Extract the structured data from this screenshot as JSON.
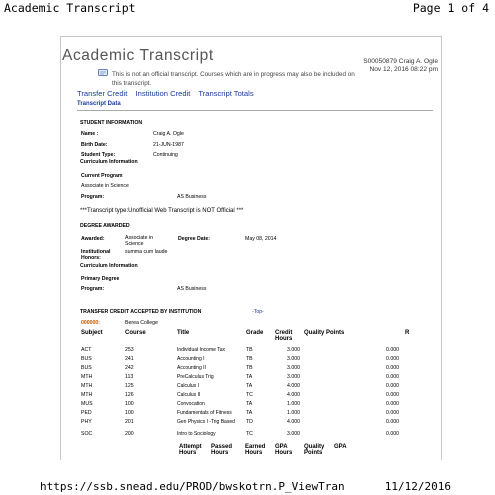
{
  "browser": {
    "page_title": "Academic Transcript",
    "page_count": "Page 1 of 4",
    "url": "https://ssb.snead.edu/PROD/bwskotrn.P_ViewTran",
    "print_date": "11/12/2016"
  },
  "header": {
    "title": "Academic Transcript",
    "student_id_name": "S00050879 Craig A. Ogle",
    "timestamp": "Nov 12, 2016 08:22 pm",
    "notice": "This is not an official transcript. Courses which are in progress may also be included on this transcript."
  },
  "nav": {
    "links": [
      "Transfer Credit",
      "Institution Credit",
      "Transcript Totals"
    ],
    "section": "Transcript Data"
  },
  "student_info": {
    "heading": "STUDENT INFORMATION",
    "name_label": "Name :",
    "name": "Craig A. Ogle",
    "birth_label": "Birth Date:",
    "birth": "21-JUN-1987",
    "type_label": "Student Type:",
    "type": "Continuing",
    "curriculum_heading": "Curriculum Information",
    "current_program_label": "Current Program",
    "current_program": "Associate in Science",
    "program_label": "Program:",
    "program": "AS Business",
    "transcript_type": "***Transcript type:Unofficial Web Transcript is NOT Official ***"
  },
  "degree": {
    "heading": "DEGREE AWARDED",
    "awarded_label": "Awarded:",
    "awarded": "Associate in Science",
    "degree_date_label": "Degree Date:",
    "degree_date": "May 08, 2014",
    "honors_label": "Institutional Honors:",
    "honors": "summa cum laude",
    "curriculum_heading": "Curriculum Information",
    "primary_label": "Primary Degree",
    "program_label": "Program:",
    "program": "AS Business"
  },
  "transfer": {
    "heading": "TRANSFER CREDIT ACCEPTED BY INSTITUTION",
    "top_link": "-Top-",
    "inst_code": "000000:",
    "inst_name": "Berea College",
    "columns": [
      "Subject",
      "Course",
      "Title",
      "Grade",
      "Credit Hours",
      "Quality Points",
      "R"
    ],
    "rows": [
      {
        "subject": "ACT",
        "course": "253",
        "title": "Individual Income Tax",
        "grade": "TB",
        "credit": "3.000",
        "qp": "0.000"
      },
      {
        "subject": "BUS",
        "course": "241",
        "title": "Accounting I",
        "grade": "TB",
        "credit": "3.000",
        "qp": "0.000"
      },
      {
        "subject": "BUS",
        "course": "242",
        "title": "Accounting II",
        "grade": "TB",
        "credit": "3.000",
        "qp": "0.000"
      },
      {
        "subject": "MTH",
        "course": "113",
        "title": "PreCalculus Trig",
        "grade": "TA",
        "credit": "3.000",
        "qp": "0.000"
      },
      {
        "subject": "MTH",
        "course": "125",
        "title": "Calculus I",
        "grade": "TA",
        "credit": "4.000",
        "qp": "0.000"
      },
      {
        "subject": "MTH",
        "course": "126",
        "title": "Calculus II",
        "grade": "TC",
        "credit": "4.000",
        "qp": "0.000"
      },
      {
        "subject": "MUS",
        "course": "100",
        "title": "Convocation",
        "grade": "TA",
        "credit": "1.000",
        "qp": "0.000"
      },
      {
        "subject": "PED",
        "course": "100",
        "title": "Fundamentals of Fitness",
        "grade": "TA",
        "credit": "1.000",
        "qp": "0.000"
      },
      {
        "subject": "PHY",
        "course": "201",
        "title": "Gen Physics I -Trig Based",
        "grade": "TD",
        "credit": "4.000",
        "qp": "0.000"
      },
      {
        "subject": "SOC",
        "course": "200",
        "title": "Intro to Sociology",
        "grade": "TC",
        "credit": "3.000",
        "qp": "0.000"
      }
    ],
    "totals_columns": [
      "Attempt Hours",
      "Passed Hours",
      "Earned Hours",
      "GPA Hours",
      "Quality Points",
      "GPA"
    ]
  }
}
